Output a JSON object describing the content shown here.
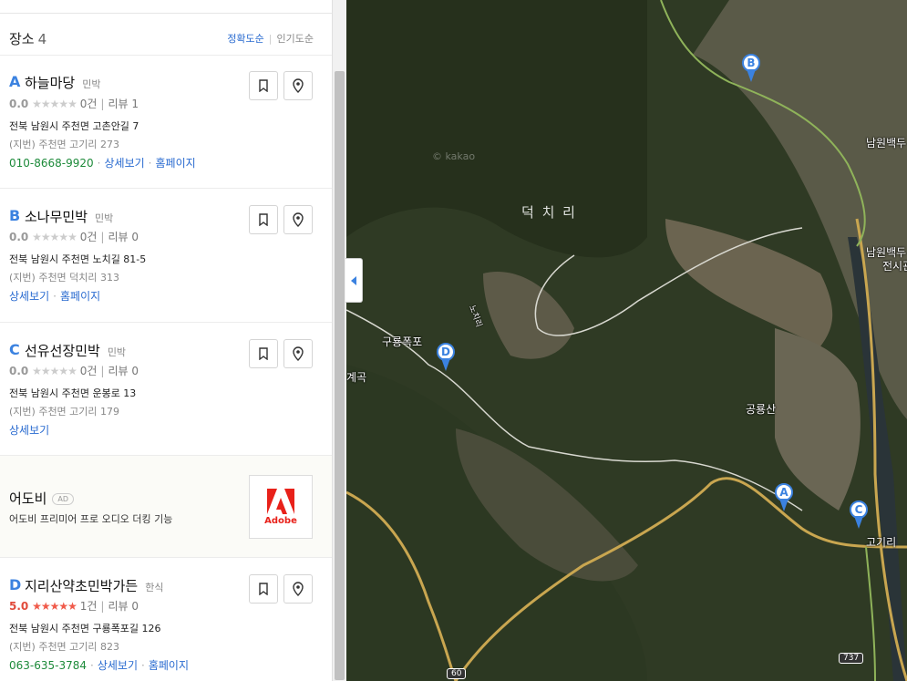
{
  "panel": {
    "title": "장소",
    "count": "4",
    "sort": {
      "accuracy": "정확도순",
      "popularity": "인기도순"
    }
  },
  "places": [
    {
      "marker": "A",
      "name": "하늘마당",
      "category": "민박",
      "score": "0.0",
      "reviews_count": "0건",
      "review_label": "리뷰 1",
      "address": "전북 남원시 주천면 고촌안길 7",
      "jibun": "(지번) 주천면 고기리 273",
      "phone": "010-8668-9920",
      "detail": "상세보기",
      "homepage": "홈페이지"
    },
    {
      "marker": "B",
      "name": "소나무민박",
      "category": "민박",
      "score": "0.0",
      "reviews_count": "0건",
      "review_label": "리뷰 0",
      "address": "전북 남원시 주천면 노치길 81-5",
      "jibun": "(지번) 주천면 덕치리 313",
      "detail": "상세보기",
      "homepage": "홈페이지"
    },
    {
      "marker": "C",
      "name": "선유선장민박",
      "category": "민박",
      "score": "0.0",
      "reviews_count": "0건",
      "review_label": "리뷰 0",
      "address": "전북 남원시 주천면 운봉로 13",
      "jibun": "(지번) 주천면 고기리 179",
      "detail": "상세보기"
    },
    {
      "marker": "D",
      "name": "지리산약초민박가든",
      "category": "한식",
      "score": "5.0",
      "reviews_count": "1건",
      "review_label": "리뷰 0",
      "address": "전북 남원시 주천면 구룡폭포길 126",
      "jibun": "(지번) 주천면 고기리 823",
      "phone": "063-635-3784",
      "detail": "상세보기",
      "homepage": "홈페이지"
    }
  ],
  "ad": {
    "name": "어도비",
    "badge": "AD",
    "description": "어도비 프리미어 프로 오디오 더킹 기능",
    "logo_text": "Adobe"
  },
  "map": {
    "labels": {
      "village": "덕 치 리",
      "waterfall": "구룡폭포",
      "mountain": "공룡산",
      "gogiri": "고기리",
      "gyegok": "계곡",
      "namwon1": "남원백두",
      "namwon2": "남원백두",
      "namwon3": "전시관",
      "watermark": "© kakao",
      "road_vert": "노치리"
    },
    "pins": [
      "A",
      "B",
      "C",
      "D"
    ],
    "routes": [
      "737",
      "60"
    ],
    "colors": {
      "pin": "#3b82e0",
      "phone": "#1d8a3a",
      "link": "#2a6bd0",
      "star_on": "#f05a4a"
    }
  }
}
